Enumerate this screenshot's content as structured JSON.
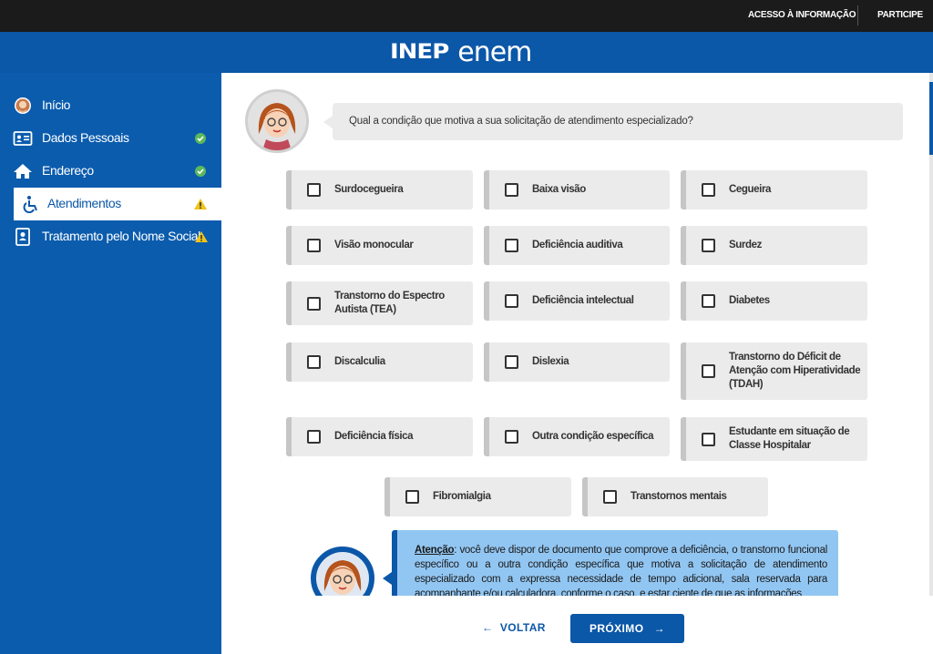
{
  "topbar": {
    "link1": "ACESSO À INFORMAÇÃO",
    "link2": "PARTICIPE"
  },
  "header": {
    "logo_inep": "INEP",
    "logo_enem": "enem"
  },
  "sidebar": {
    "items": [
      {
        "label": "Início",
        "icon": "avatar-icon",
        "status": ""
      },
      {
        "label": "Dados Pessoais",
        "icon": "id-card-icon",
        "status": "complete"
      },
      {
        "label": "Endereço",
        "icon": "home-icon",
        "status": "complete"
      },
      {
        "label": "Atendimentos",
        "icon": "wheelchair-icon",
        "status": "warning"
      },
      {
        "label": "Tratamento pelo Nome Social",
        "icon": "badge-icon",
        "status": "warning"
      }
    ]
  },
  "question": {
    "text": "Qual a condição que motiva a sua solicitação de atendimento especializado?"
  },
  "options": [
    "Surdocegueira",
    "Baixa visão",
    "Cegueira",
    "Visão monocular",
    "Deficiência auditiva",
    "Surdez",
    "Transtorno do Espectro Autista (TEA)",
    "Deficiência intelectual",
    "Diabetes",
    "Discalculia",
    "Dislexia",
    "Transtorno do Déficit de Atenção com Hiperatividade (TDAH)",
    "Deficiência física",
    "Outra condição específica",
    "Estudante em situação de Classe Hospitalar",
    "Fibromialgia",
    "Transtornos mentais"
  ],
  "attention": {
    "label": "Atenção",
    "text": ": você deve dispor de documento que comprove a deficiência, o transtorno funcional específico ou a outra condição específica que motiva a solicitação de atendimento especializado com a expressa necessidade de tempo adicional, sala reservada para acompanhante e/ou calculadora, conforme o caso, e estar ciente de que as informações"
  },
  "buttons": {
    "back": "VOLTAR",
    "next": "PRÓXIMO"
  },
  "colors": {
    "primary": "#0b57a8",
    "success": "#5cb85c",
    "warning": "#f0c419",
    "option_bg": "#ebebeb",
    "attention_bg": "#92c6f2"
  }
}
